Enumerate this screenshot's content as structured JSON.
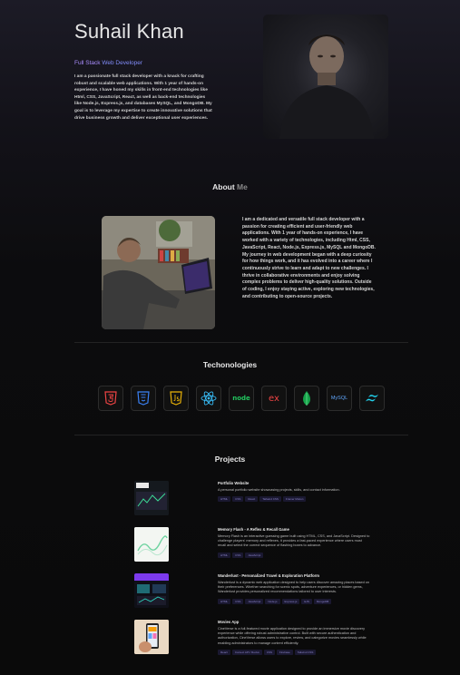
{
  "hero": {
    "name": "Suhail Khan",
    "role_a": "Full Stack",
    "role_b": " Web Developer",
    "description": "I am a passionate full stack developer with a knack for crafting robust and scalable web applications. With 1 year of hands-on experience, I have honed my skills in front-end technologies like Html, CSS, JavaScript, React, as well as back-end technologies like Node.js, Express.js, and databases MySQL, and MongoDB. My goal is to leverage my expertise to create innovative solutions that drive business growth and deliver exceptional user experiences."
  },
  "about": {
    "title_main": "About",
    "title_accent": " Me",
    "text": "I am a dedicated and versatile full stack developer with a passion for creating efficient and user-friendly web applications. With 1 year of hands-on experience, I have worked with a variety of technologies, including Html, CSS, JavaScript, React, Node.js, Express.js, MySQL and MongoDB. My journey in web development began with a deep curiosity for how things work, and it has evolved into a career where I continuously strive to learn and adapt to new challenges. I thrive in collaborative environments and enjoy solving complex problems to deliver high-quality solutions. Outside of coding, I enjoy staying active, exploring new technologies, and contributing to open-source projects."
  },
  "technologies": {
    "title": "Techonologies",
    "items": [
      "html5-icon",
      "css3-icon",
      "javascript-icon",
      "react-icon",
      "nodejs-icon",
      "express-icon",
      "mongodb-icon",
      "mysql-icon",
      "tailwind-icon"
    ],
    "icon_labels": {
      "nodejs": "node",
      "express": "ex",
      "mysql": "MySQL"
    }
  },
  "projects": {
    "title": "Projects",
    "items": [
      {
        "title": "Portfolio Website",
        "description": "A personal portfolio website showcasing projects, skills, and contact information.",
        "tags": [
          "HTML",
          "CSS",
          "React",
          "Tailwind CSS",
          "Framer Motion"
        ]
      },
      {
        "title": "Memory Flash - A Reflex & Recall Game",
        "description": "Memory Flash is an interactive guessing game built using HTML, CSS, and JavaScript. Designed to challenge players' memory and reflexes, it provides a fast-paced experience where users must recall and select the correct sequence of flashing boxes to advance.",
        "tags": [
          "HTML",
          "CSS",
          "JavaScript"
        ]
      },
      {
        "title": "Wanderlust - Personalized Travel & Exploration Platform",
        "description": "Wanderlust is a dynamic web application designed to help users discover amazing places based on their preferences. Whether searching for scenic spots, adventure experiences, or hidden gems, Wanderlust provides personalized recommendations tailored to user interests.",
        "tags": [
          "HTML",
          "CSS",
          "JavaScript",
          "Node.js",
          "Express.js",
          "EJS",
          "MongoDB"
        ]
      },
      {
        "title": "Movies App",
        "description": "CineVerse is a full-featured movie application designed to provide an immersive movie discovery experience while offering robust administrative control. Built with secure authentication and authorization, CineVerse allows users to explore, review, and categorize movies seamlessly while enabling administrators to manage content efficiently.",
        "tags": [
          "React",
          "Context API / Redux",
          "CSS",
          "Firebase",
          "Tailwind CSS"
        ]
      }
    ]
  },
  "colors": {
    "accent_purple": "#a78bfa",
    "accent_indigo": "#818cf8",
    "background": "#0a0a0a"
  }
}
